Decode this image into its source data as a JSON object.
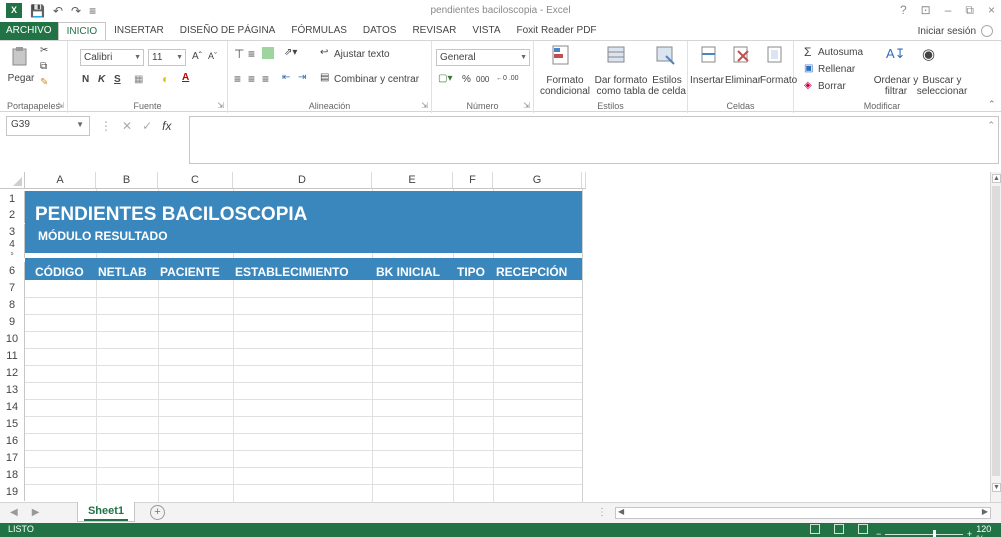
{
  "app": {
    "title": "pendientes baciloscopia - Excel",
    "logo": "X",
    "signin": "Iniciar sesión",
    "window_controls": [
      "?",
      "⊡",
      "–",
      "⧉",
      "×"
    ]
  },
  "tabs": [
    {
      "label": "ARCHIVO"
    },
    {
      "label": "INICIO"
    },
    {
      "label": "INSERTAR"
    },
    {
      "label": "DISEÑO DE PÁGINA"
    },
    {
      "label": "FÓRMULAS"
    },
    {
      "label": "DATOS"
    },
    {
      "label": "REVISAR"
    },
    {
      "label": "VISTA"
    },
    {
      "label": "Foxit Reader PDF"
    }
  ],
  "ribbon": {
    "clipboard": {
      "label": "Portapapeles",
      "paste": "Pegar"
    },
    "font": {
      "label": "Fuente",
      "name": "Calibri",
      "size": "11",
      "bold": "N",
      "italic": "K",
      "underline": "S"
    },
    "alignment": {
      "label": "Alineación",
      "wrap": "Ajustar texto",
      "merge": "Combinar y centrar"
    },
    "number": {
      "label": "Número",
      "format": "General",
      "percent": "%",
      "thousands": "000",
      "inc_dec": "←0 .00",
      "dec_dec": ".00 →0"
    },
    "styles": {
      "label": "Estilos",
      "conditional": "Formato condicional",
      "table": "Dar formato como tabla",
      "cell": "Estilos de celda"
    },
    "cells": {
      "label": "Celdas",
      "insert": "Insertar",
      "delete": "Eliminar",
      "format": "Formato"
    },
    "editing": {
      "label": "Modificar",
      "autosum": "Autosuma",
      "fill": "Rellenar",
      "clear": "Borrar",
      "sort": "Ordenar y filtrar",
      "find": "Buscar y seleccionar"
    }
  },
  "formula_bar": {
    "name_box": "G39",
    "fx": "fx",
    "value": ""
  },
  "grid": {
    "columns": [
      "A",
      "B",
      "C",
      "D",
      "E",
      "F",
      "G"
    ],
    "rows": [
      "1",
      "2",
      "3",
      "4",
      "5",
      "6",
      "7",
      "8",
      "9",
      "10",
      "11",
      "12",
      "13",
      "14",
      "15",
      "16",
      "17",
      "18",
      "19"
    ],
    "banner_color": "#3a87be",
    "title": "PENDIENTES BACILOSCOPIA",
    "subtitle": "MÓDULO RESULTADO",
    "headers": [
      "CÓDIGO",
      "NETLAB",
      "PACIENTE",
      "ESTABLECIMIENTO",
      "BK INICIAL",
      "TIPO",
      "RECEPCIÓN"
    ]
  },
  "sheets": {
    "active": "Sheet1"
  },
  "status": {
    "text": "LISTO",
    "zoom": "120 %"
  },
  "colors": {
    "accent": "#217346"
  }
}
